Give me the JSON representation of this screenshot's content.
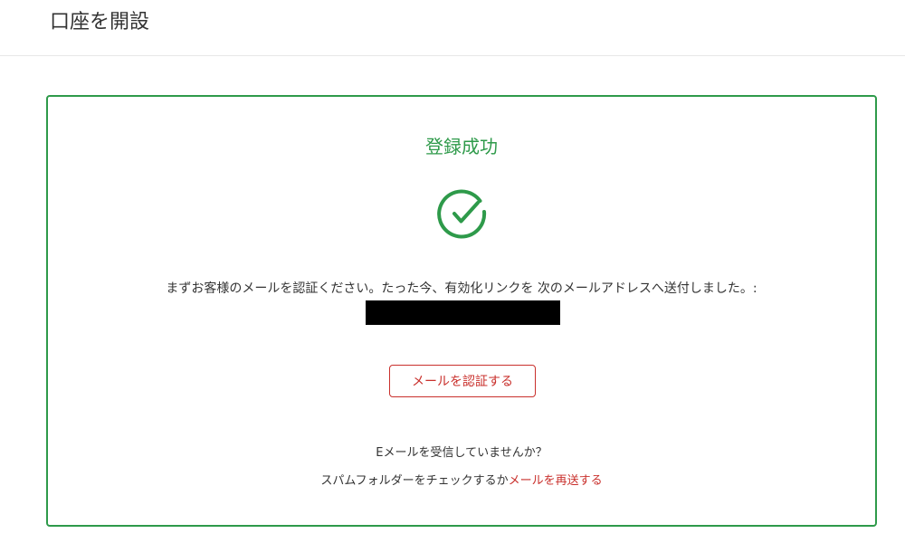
{
  "header": {
    "title": "口座を開設"
  },
  "card": {
    "title": "登録成功",
    "icon": "check-circle-icon",
    "message": "まずお客様のメールを認証ください。たった今、有効化リンクを 次のメールアドレスへ送付しました。:",
    "verify_button_label": "メールを認証する",
    "no_mail_text": "Eメールを受信していませんか？",
    "spam_text": "スパムフォルダーをチェックするか",
    "resend_link_label": "メールを再送する"
  },
  "colors": {
    "success": "#2e9a4a",
    "accent": "#c9302c",
    "redaction": "#000000"
  }
}
